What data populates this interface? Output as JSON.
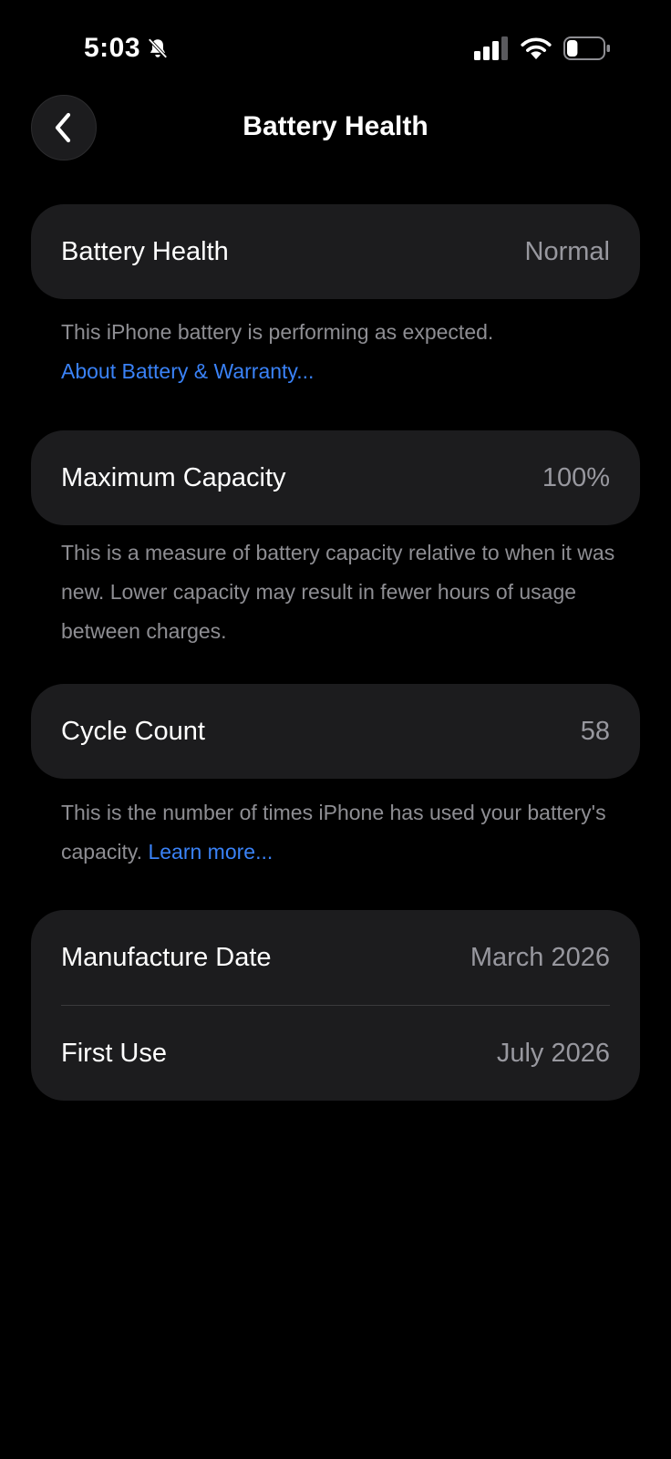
{
  "status_bar": {
    "time": "5:03",
    "icons": [
      "bell-slash-icon",
      "cellular-signal-icon",
      "wifi-icon",
      "battery-icon"
    ],
    "battery_level": 0.3
  },
  "nav": {
    "title": "Battery Health",
    "back_icon": "chevron-left-icon"
  },
  "battery_health": {
    "label": "Battery Health",
    "value": "Normal",
    "note": "This iPhone battery is performing as expected.",
    "link": "About Battery & Warranty..."
  },
  "maximum_capacity": {
    "label": "Maximum Capacity",
    "value": "100%",
    "note": "This is a measure of battery capacity relative to when it was new. Lower capacity may result in fewer hours of usage between charges."
  },
  "cycle_count": {
    "label": "Cycle Count",
    "value": "58",
    "note": "This is the number of times iPhone has used your battery's capacity.",
    "link": "Learn more..."
  },
  "dates": {
    "manufacture_label": "Manufacture Date",
    "manufacture_value": "March 2026",
    "first_use_label": "First Use",
    "first_use_value": "July 2026"
  },
  "colors": {
    "background": "#000000",
    "card": "#1c1c1e",
    "secondary_text": "#98989f",
    "link": "#3a82f7"
  }
}
